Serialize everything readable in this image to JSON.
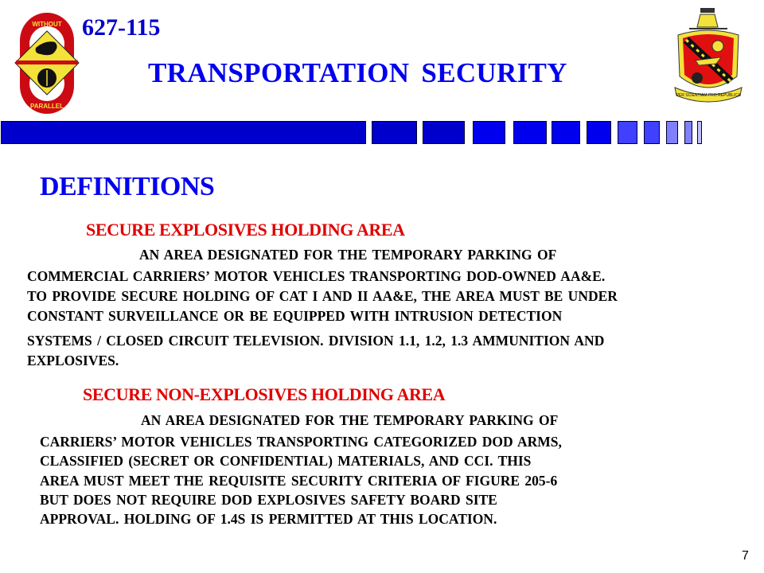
{
  "header": {
    "course_number": "627-115",
    "title": "TRANSPORTATION  SECURITY",
    "left_logo": {
      "icon": "unit-insignia-icon",
      "top_text": "WITHOUT",
      "bottom_text": "PARALLEL"
    },
    "right_logo": {
      "icon": "crest-icon",
      "motto": "PER SCIENTIAM PRO REPUBLICA"
    }
  },
  "decor_bar": {
    "colors": [
      "#0000cc",
      "#0000cc",
      "#0000ee",
      "#0000ee",
      "#0000ee",
      "#0000ee",
      "#4040ff",
      "#4040ff",
      "#8080ff",
      "#8080ff",
      "#c0c0ff",
      "#c0c0ff"
    ]
  },
  "content": {
    "heading": "DEFINITIONS",
    "sections": [
      {
        "subheading": "SECURE EXPLOSIVES HOLDING AREA",
        "lines": [
          "AN AREA DESIGNATED  FOR THE TEMPORARY  PARKING  OF",
          "COMMERCIAL  CARRIERS’ MOTOR VEHICLES TRANSPORTING  DOD-OWNED AA&E.",
          "TO PROVIDE  SECURE HOLDING OF CAT I AND II AA&E, THE AREA MUST BE UNDER",
          "CONSTANT  SURVEILLANCE OR BE EQUIPPED WITH INTRUSION DETECTION",
          "SYSTEMS / CLOSED  CIRCUIT  TELEVISION.  DIVISION  1.1, 1.2, 1.3 AMMUNITION  AND",
          "EXPLOSIVES."
        ]
      },
      {
        "subheading": "SECURE NON-EXPLOSIVES HOLDING AREA",
        "lines": [
          "AN AREA DESIGNATED  FOR THE TEMPORARY  PARKING  OF",
          "CARRIERS’ MOTOR VEHICLES  TRANSPORTING  CATEGORIZED  DOD ARMS,",
          "CLASSIFIED (SECRET OR CONFIDENTIAL)  MATERIALS,  AND CCI.  THIS",
          "AREA MUST MEET THE REQUISITE  SECURITY CRITERIA OF FIGURE 205-6",
          "BUT DOES NOT REQUIRE  DOD EXPLOSIVES  SAFETY BOARD SITE",
          "APPROVAL.  HOLDING  OF 1.4S IS PERMITTED AT THIS LOCATION."
        ]
      }
    ]
  },
  "footer": {
    "page_number": "7"
  }
}
